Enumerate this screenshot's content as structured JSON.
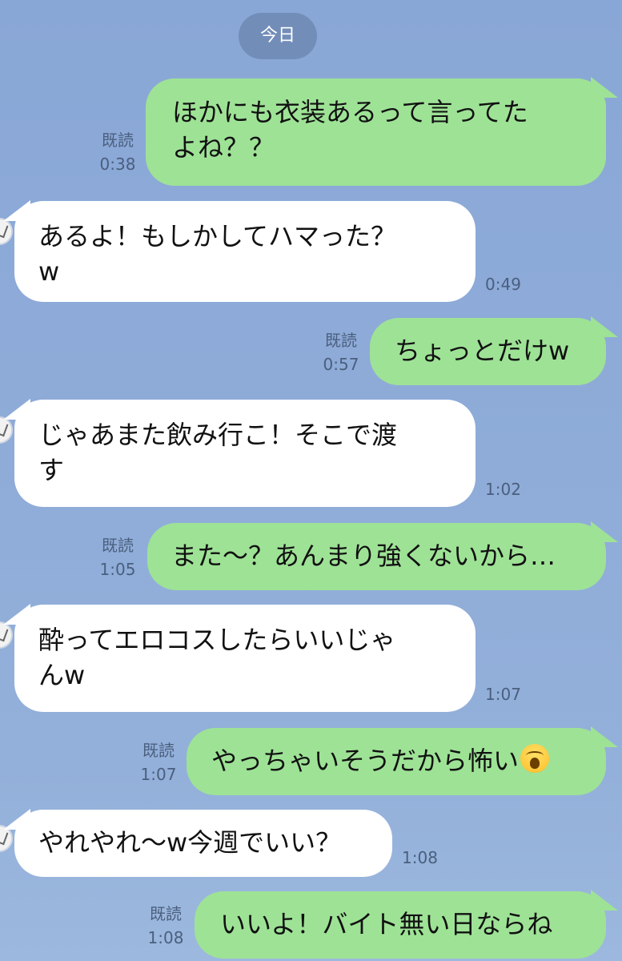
{
  "chat": {
    "date_label": "今日",
    "read_label": "既読",
    "messages": [
      {
        "side": "out",
        "lines": [
          "ほかにも衣装あるって言ってた",
          "よね？？"
        ],
        "time": "0:38"
      },
      {
        "side": "in",
        "lines": [
          "あるよ！もしかしてハマった？",
          "w"
        ],
        "time": "0:49"
      },
      {
        "side": "out",
        "lines": [
          "ちょっとだけw"
        ],
        "time": "0:57"
      },
      {
        "side": "in",
        "lines": [
          "じゃあまた飲み行こ！そこで渡",
          "す"
        ],
        "time": "1:02"
      },
      {
        "side": "out",
        "lines": [
          "また〜？あんまり強くないから…"
        ],
        "time": "1:05"
      },
      {
        "side": "in",
        "lines": [
          "酔ってエロコスしたらいいじゃ",
          "んw"
        ],
        "time": "1:07"
      },
      {
        "side": "out",
        "lines": [
          "やっちゃいそうだから怖い"
        ],
        "time": "1:07",
        "emoji": "face-screaming-in-fear-icon"
      },
      {
        "side": "in",
        "lines": [
          "やれやれ〜w今週でいい？"
        ],
        "time": "1:08"
      },
      {
        "side": "out",
        "lines": [
          "いいよ！バイト無い日ならね"
        ],
        "time": "1:08"
      }
    ]
  },
  "colors": {
    "background": "#8eabd8",
    "outgoing_bubble": "#9ee296",
    "incoming_bubble": "#ffffff",
    "date_pill": "#6f87ad",
    "meta_text": "#4a5f7e"
  }
}
